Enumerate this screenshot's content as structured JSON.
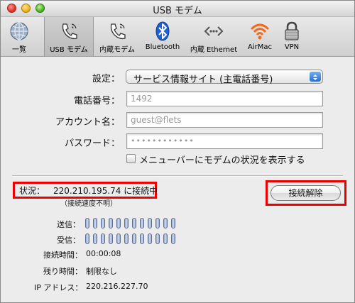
{
  "window": {
    "title": "USB モデム"
  },
  "toolbar": {
    "items": [
      {
        "label": "一覧",
        "icon": "globe-icon"
      },
      {
        "label": "USB モデム",
        "icon": "phone-icon"
      },
      {
        "label": "内蔵モデム",
        "icon": "phone-icon"
      },
      {
        "label": "Bluetooth",
        "icon": "bluetooth-icon"
      },
      {
        "label": "内蔵 Ethernet",
        "icon": "ethernet-icon"
      },
      {
        "label": "AirMac",
        "icon": "airmac-icon"
      },
      {
        "label": "VPN",
        "icon": "lock-icon"
      }
    ],
    "selected": "USB モデム"
  },
  "form": {
    "settings_label": "設定：",
    "settings_value": "サービス情報サイト (主電話番号)",
    "phone_label": "電話番号：",
    "phone_value": "1492",
    "account_label": "アカウント名：",
    "account_value": "guest@flets",
    "password_label": "パスワード：",
    "password_value": "••••••••••••",
    "show_status_checkbox": "メニューバーにモデムの状況を表示する",
    "show_status_checked": false
  },
  "status": {
    "label": "状況：",
    "value": "220.210.195.74 に接続中",
    "sub": "（接続速度不明）",
    "disconnect_button": "接続解除",
    "send_label": "送信：",
    "receive_label": "受信：",
    "connect_time_label": "接続時間：",
    "connect_time": "00:00:08",
    "remaining_label": "残り時間：",
    "remaining": "制限なし",
    "ip_label": "IP アドレス：",
    "ip": "220.216.227.70"
  },
  "colors": {
    "highlight_red": "#ee0000",
    "popup_arrow_blue": "#2a6fd0",
    "bluetooth_blue": "#1e5fd6",
    "airmac_orange": "#f26b1d"
  }
}
